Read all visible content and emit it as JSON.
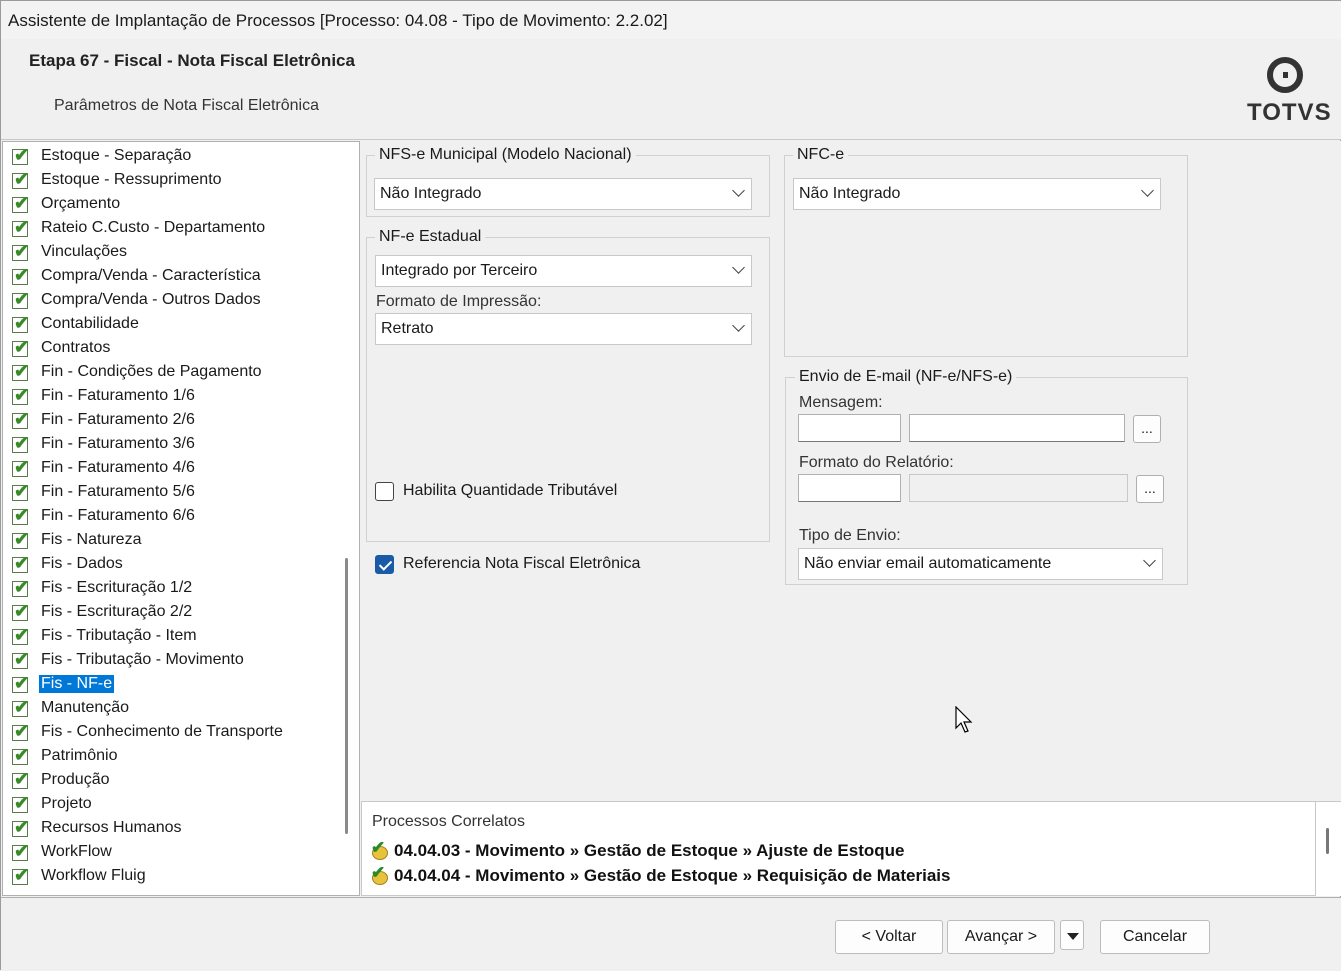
{
  "window": {
    "title": "Assistente de Implantação de Processos [Processo: 04.08 - Tipo de Movimento: 2.2.02]"
  },
  "header": {
    "step_title": "Etapa 67 - Fiscal - Nota Fiscal Eletrônica",
    "step_subtitle": "Parâmetros de Nota Fiscal Eletrônica",
    "logo_text": "TOTVS"
  },
  "tree": {
    "items": [
      {
        "label": "Estoque - Separação"
      },
      {
        "label": "Estoque - Ressuprimento"
      },
      {
        "label": "Orçamento"
      },
      {
        "label": "Rateio C.Custo - Departamento"
      },
      {
        "label": "Vinculações"
      },
      {
        "label": "Compra/Venda - Característica"
      },
      {
        "label": "Compra/Venda - Outros Dados"
      },
      {
        "label": "Contabilidade"
      },
      {
        "label": "Contratos"
      },
      {
        "label": "Fin - Condições de Pagamento"
      },
      {
        "label": "Fin - Faturamento 1/6"
      },
      {
        "label": "Fin - Faturamento 2/6"
      },
      {
        "label": "Fin - Faturamento 3/6"
      },
      {
        "label": "Fin - Faturamento 4/6"
      },
      {
        "label": "Fin - Faturamento 5/6"
      },
      {
        "label": "Fin - Faturamento 6/6"
      },
      {
        "label": "Fis - Natureza"
      },
      {
        "label": "Fis - Dados"
      },
      {
        "label": "Fis - Escrituração 1/2"
      },
      {
        "label": "Fis - Escrituração 2/2"
      },
      {
        "label": "Fis - Tributação - Item"
      },
      {
        "label": "Fis - Tributação - Movimento"
      },
      {
        "label": "Fis - NF-e",
        "selected": true
      },
      {
        "label": "Manutenção"
      },
      {
        "label": "Fis - Conhecimento de Transporte"
      },
      {
        "label": "Patrimônio"
      },
      {
        "label": "Produção"
      },
      {
        "label": "Projeto"
      },
      {
        "label": "Recursos Humanos"
      },
      {
        "label": "WorkFlow"
      },
      {
        "label": "Workflow Fluig"
      }
    ]
  },
  "form": {
    "nfse": {
      "legend": "NFS-e Municipal (Modelo Nacional)",
      "value": "Não Integrado"
    },
    "nfce": {
      "legend": "NFC-e",
      "value": "Não Integrado"
    },
    "nfe_estadual": {
      "legend": "NF-e Estadual",
      "value": "Integrado por Terceiro",
      "print_format_label": "Formato de Impressão:",
      "print_format_value": "Retrato",
      "habilita_label": "Habilita Quantidade Tributável",
      "habilita_checked": false
    },
    "referencia_label": "Referencia Nota Fiscal Eletrônica",
    "referencia_checked": true,
    "email": {
      "legend": "Envio de E-mail (NF-e/NFS-e)",
      "mensagem_label": "Mensagem:",
      "formato_label": "Formato do Relatório:",
      "tipo_label": "Tipo de Envio:",
      "tipo_value": "Não enviar email automaticamente",
      "ellipsis": "..."
    }
  },
  "related": {
    "title": "Processos Correlatos",
    "items": [
      "04.04.03 - Movimento » Gestão de Estoque » Ajuste de Estoque",
      "04.04.04 - Movimento » Gestão de Estoque » Requisição de Materiais"
    ]
  },
  "footer": {
    "back_label": "< Voltar",
    "next_label": "Avançar >",
    "cancel_label": "Cancelar"
  }
}
